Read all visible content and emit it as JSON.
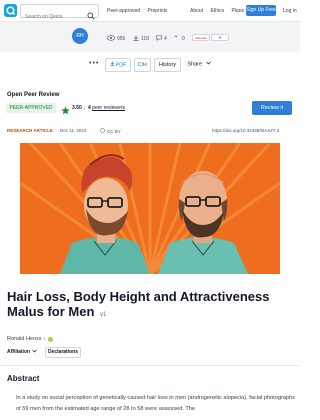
{
  "nav": {
    "search_placeholder": "Search on Qeios",
    "peer_approved": "Peer-approved",
    "preprints": "Preprints",
    "about": "About",
    "ethics": "Ethics",
    "plans": "Plans",
    "signup": "Sign Up Free",
    "login": "Log in"
  },
  "stats": {
    "avatar_initials": "RH",
    "views": "955",
    "downloads": "118",
    "comments": "4",
    "citations": "0",
    "altmetric": "Altmetric",
    "add": "+"
  },
  "toolbar": {
    "pdf": "PDF",
    "cite": "Cite",
    "history": "History",
    "share": "Share"
  },
  "review": {
    "title": "Open Peer Review",
    "badge": "PEER-APPROVED",
    "rating": "3.50",
    "separator": "|",
    "reviewers_count": "4",
    "reviewers_label": "peer reviewers",
    "review_button": "Review it"
  },
  "meta": {
    "type": "RESEARCH ARTICLE",
    "date": "Dec 11, 2024",
    "license": "CC BY",
    "doi": "https://doi.org/10.32388/MAXZ7.2"
  },
  "article": {
    "title": "Hair Loss, Body Height and Attractiveness Malus for Men",
    "version": "v1",
    "author": "Ronald Henss",
    "author_sup": "1",
    "affiliation": "Affiliation",
    "declarations": "Declarations"
  },
  "abstract": {
    "heading": "Abstract",
    "text": "In a study on social perception of genetically caused hair loss in men (androgenetic alopecia), facial photographs of 59 men from the estimated age range of 28 to 58 were assessed. The"
  },
  "colors": {
    "brand": "#2f7fd6",
    "approved_bg": "#e6f4ea",
    "approved_text": "#188038",
    "article_type": "#b45309",
    "figure_bg": "#ef6d1f"
  }
}
